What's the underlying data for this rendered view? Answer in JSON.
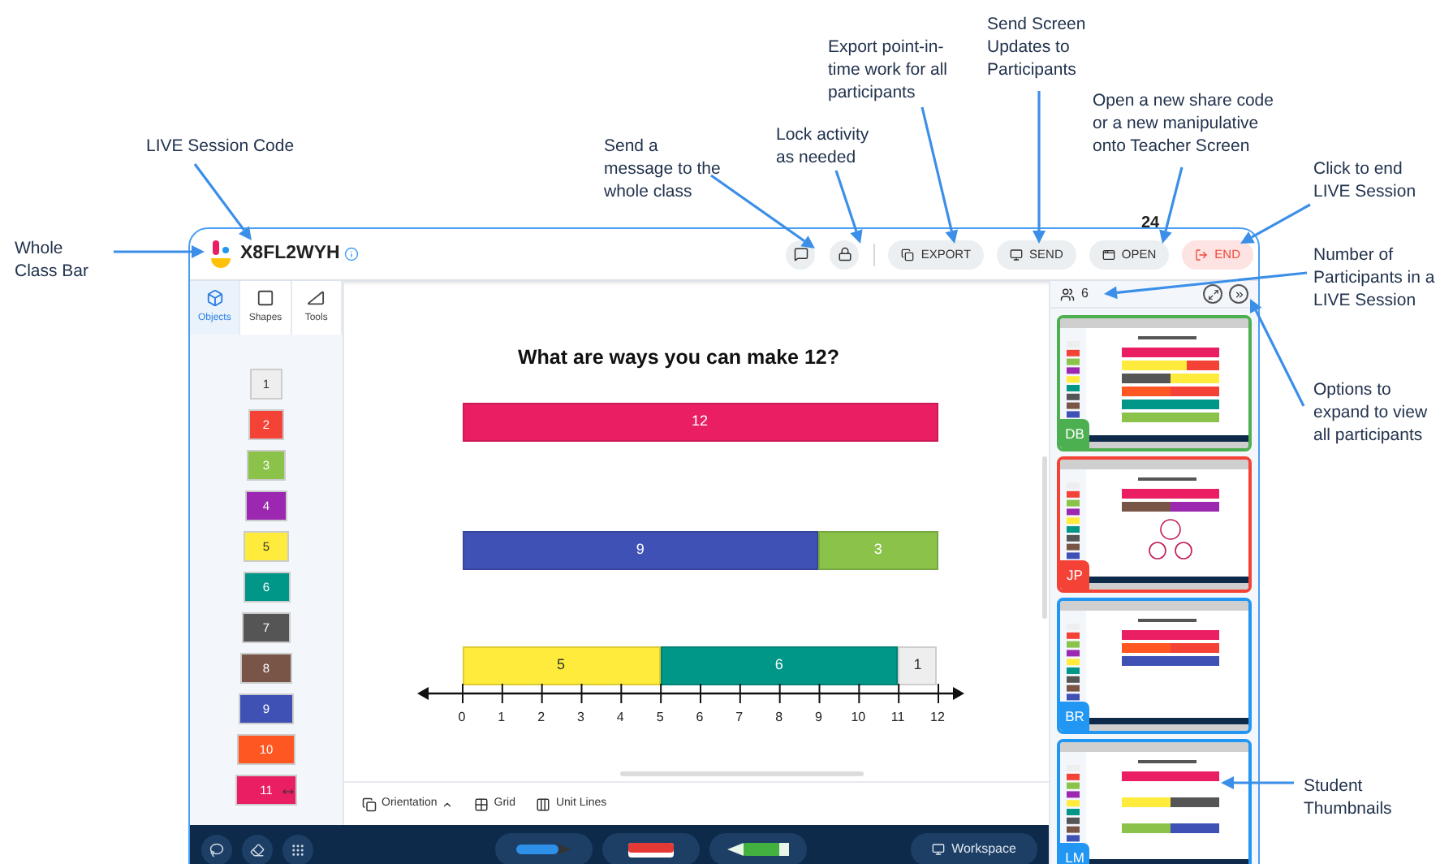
{
  "annotations": [
    {
      "lines": [
        "Whole",
        "Class Bar"
      ]
    },
    {
      "lines": [
        "LIVE Session Code"
      ]
    },
    {
      "lines": [
        "Send a",
        "message to the",
        "whole class"
      ]
    },
    {
      "lines": [
        "Lock activity",
        "as needed"
      ]
    },
    {
      "lines": [
        "Export point-in-",
        "time work for all",
        "participants"
      ]
    },
    {
      "lines": [
        "Send Screen",
        "Updates to",
        "Participants"
      ]
    },
    {
      "lines": [
        "Open a new share code",
        "or a new manipulative",
        "onto Teacher Screen"
      ]
    },
    {
      "lines": [
        "Click to end",
        "LIVE Session"
      ]
    },
    {
      "lines": [
        "Number of",
        "Participants in a",
        "LIVE Session"
      ]
    },
    {
      "lines": [
        "Options to",
        "expand to view",
        "all participants"
      ]
    },
    {
      "lines": [
        "Student",
        "Thumbnails"
      ]
    }
  ],
  "badge_count": "24",
  "header": {
    "session_code": "X8FL2WYH",
    "icon_buttons": [
      {
        "kind": "message"
      },
      {
        "kind": "lock"
      }
    ],
    "buttons": [
      {
        "kind": "export",
        "label": "EXPORT"
      },
      {
        "kind": "send",
        "label": "SEND"
      },
      {
        "kind": "open",
        "label": "OPEN"
      },
      {
        "kind": "end",
        "label": "END"
      }
    ]
  },
  "sidebar": {
    "tabs": [
      {
        "kind": "objects",
        "label": "Objects",
        "selected": true
      },
      {
        "kind": "shapes",
        "label": "Shapes",
        "selected": false
      },
      {
        "kind": "tools",
        "label": "Tools",
        "selected": false
      }
    ],
    "tiles": [
      {
        "label": "1",
        "color": "#eeeeee"
      },
      {
        "label": "2",
        "color": "#f44336"
      },
      {
        "label": "3",
        "color": "#8bc34a"
      },
      {
        "label": "4",
        "color": "#9c27b0"
      },
      {
        "label": "5",
        "color": "#ffeb3b"
      },
      {
        "label": "6",
        "color": "#009688"
      },
      {
        "label": "7",
        "color": "#555555"
      },
      {
        "label": "8",
        "color": "#795548"
      },
      {
        "label": "9",
        "color": "#3f51b5"
      },
      {
        "label": "10",
        "color": "#ff5722"
      },
      {
        "label": "11",
        "color": "#e91e63"
      }
    ]
  },
  "canvas": {
    "title": "What are ways you can make 12?",
    "rows": [
      {
        "parts": [
          {
            "label": "12",
            "color": "#e91e63"
          }
        ]
      },
      {
        "parts": [
          {
            "label": "9",
            "color": "#3f51b5"
          },
          {
            "label": "3",
            "color": "#8bc34a"
          }
        ]
      },
      {
        "parts": [
          {
            "label": "5",
            "color": "#ffeb3b"
          },
          {
            "label": "6",
            "color": "#009688"
          },
          {
            "label": "1",
            "color": "#eeeeee"
          }
        ]
      }
    ],
    "number_line": [
      "0",
      "1",
      "2",
      "3",
      "4",
      "5",
      "6",
      "7",
      "8",
      "9",
      "10",
      "11",
      "12"
    ]
  },
  "canvas_toolbar": [
    {
      "kind": "orientation",
      "label": "Orientation"
    },
    {
      "kind": "grid",
      "label": "Grid"
    },
    {
      "kind": "unit_lines",
      "label": "Unit Lines"
    }
  ],
  "workspace_button": "Workspace",
  "participants": {
    "count": "6",
    "thumbnails": [
      {
        "initials": "DB",
        "color": "#4caf50"
      },
      {
        "initials": "JP",
        "color": "#f44336"
      },
      {
        "initials": "BR",
        "color": "#2196f3"
      },
      {
        "initials": "LM",
        "color": "#2196f3"
      }
    ]
  }
}
